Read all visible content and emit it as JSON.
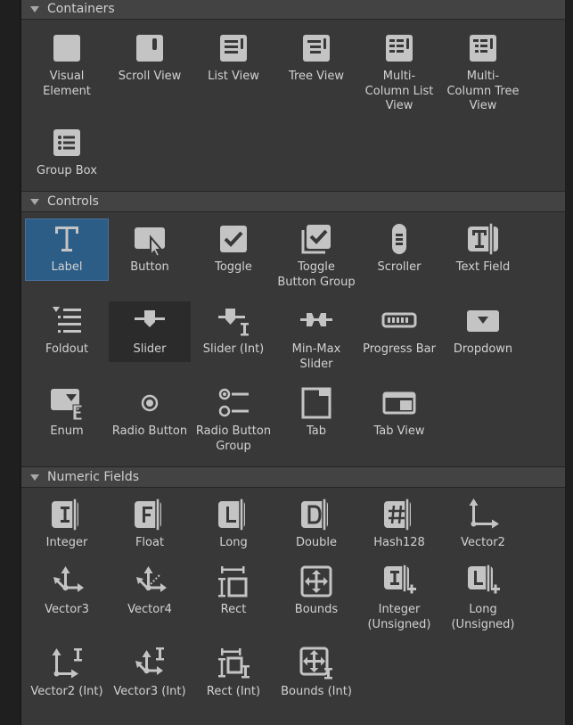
{
  "sections": [
    {
      "title": "Containers",
      "items": [
        {
          "label": "Visual\nElement",
          "icon": "visual-element-icon"
        },
        {
          "label": "Scroll View",
          "icon": "scroll-view-icon"
        },
        {
          "label": "List View",
          "icon": "list-view-icon"
        },
        {
          "label": "Tree View",
          "icon": "tree-view-icon"
        },
        {
          "label": "Multi-\nColumn List\nView",
          "icon": "multi-column-list-view-icon"
        },
        {
          "label": "Multi-\nColumn Tree\nView",
          "icon": "multi-column-tree-view-icon"
        },
        {
          "label": "Group Box",
          "icon": "group-box-icon"
        }
      ]
    },
    {
      "title": "Controls",
      "items": [
        {
          "label": "Label",
          "icon": "label-icon",
          "state": "selected"
        },
        {
          "label": "Button",
          "icon": "button-icon"
        },
        {
          "label": "Toggle",
          "icon": "toggle-icon"
        },
        {
          "label": "Toggle\nButton Group",
          "icon": "toggle-button-group-icon"
        },
        {
          "label": "Scroller",
          "icon": "scroller-icon"
        },
        {
          "label": "Text Field",
          "icon": "text-field-icon"
        },
        {
          "label": "Foldout",
          "icon": "foldout-icon"
        },
        {
          "label": "Slider",
          "icon": "slider-icon",
          "state": "hover"
        },
        {
          "label": "Slider (Int)",
          "icon": "slider-int-icon"
        },
        {
          "label": "Min-Max\nSlider",
          "icon": "min-max-slider-icon"
        },
        {
          "label": "Progress Bar",
          "icon": "progress-bar-icon"
        },
        {
          "label": "Dropdown",
          "icon": "dropdown-icon"
        },
        {
          "label": "Enum",
          "icon": "enum-icon"
        },
        {
          "label": "Radio Button",
          "icon": "radio-button-icon"
        },
        {
          "label": "Radio Button\nGroup",
          "icon": "radio-button-group-icon"
        },
        {
          "label": "Tab",
          "icon": "tab-icon"
        },
        {
          "label": "Tab View",
          "icon": "tab-view-icon"
        }
      ]
    },
    {
      "title": "Numeric Fields",
      "items": [
        {
          "label": "Integer",
          "icon": "integer-icon"
        },
        {
          "label": "Float",
          "icon": "float-icon"
        },
        {
          "label": "Long",
          "icon": "long-icon"
        },
        {
          "label": "Double",
          "icon": "double-icon"
        },
        {
          "label": "Hash128",
          "icon": "hash128-icon"
        },
        {
          "label": "Vector2",
          "icon": "vector2-icon"
        },
        {
          "label": "Vector3",
          "icon": "vector3-icon"
        },
        {
          "label": "Vector4",
          "icon": "vector4-icon"
        },
        {
          "label": "Rect",
          "icon": "rect-icon"
        },
        {
          "label": "Bounds",
          "icon": "bounds-icon"
        },
        {
          "label": "Integer\n(Unsigned)",
          "icon": "integer-unsigned-icon"
        },
        {
          "label": "Long\n(Unsigned)",
          "icon": "long-unsigned-icon"
        },
        {
          "label": "Vector2 (Int)",
          "icon": "vector2-int-icon"
        },
        {
          "label": "Vector3 (Int)",
          "icon": "vector3-int-icon"
        },
        {
          "label": "Rect (Int)",
          "icon": "rect-int-icon"
        },
        {
          "label": "Bounds (Int)",
          "icon": "bounds-int-icon"
        }
      ]
    }
  ],
  "colors": {
    "panel": "#383838",
    "header": "#434343",
    "selected": "#2c5d87",
    "icon": "#c4c4c4",
    "text": "#d2d2d2"
  }
}
